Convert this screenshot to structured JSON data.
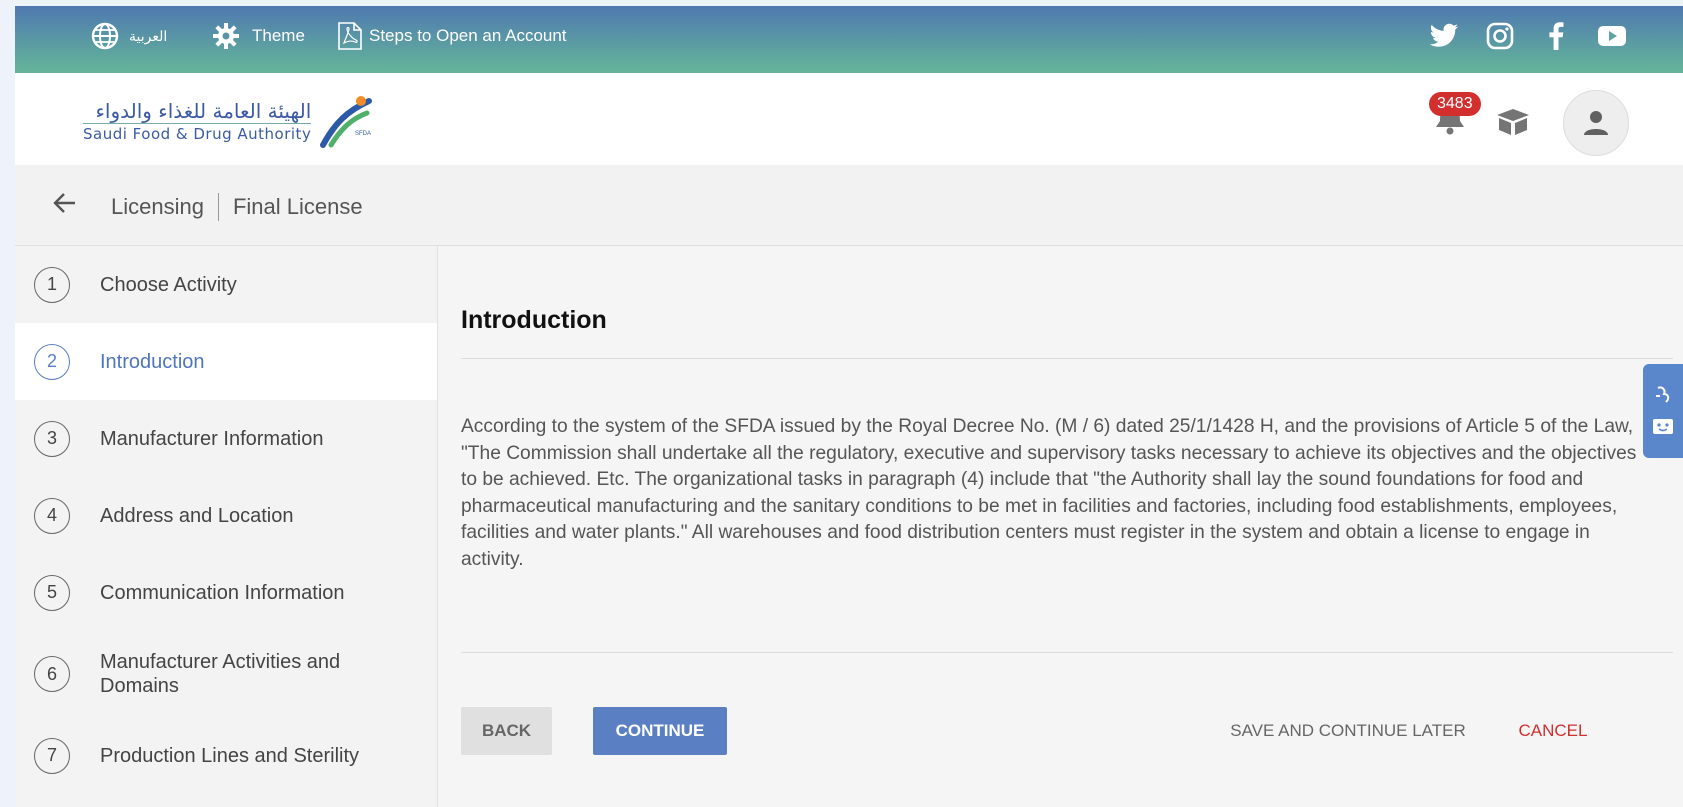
{
  "topbar": {
    "language_label": "العربية",
    "theme_label": "Theme",
    "steps_label": "Steps to Open an Account",
    "social_icons": [
      "twitter-icon",
      "instagram-icon",
      "facebook-icon",
      "youtube-icon"
    ]
  },
  "header": {
    "logo_arabic": "الهيئة العامة للغذاء والدواء",
    "logo_english": "Saudi Food & Drug Authority",
    "logo_mark_text": "SFDA",
    "notification_count": "3483"
  },
  "breadcrumb": {
    "section": "Licensing",
    "page": "Final License"
  },
  "steps": [
    {
      "number": "1",
      "label": "Choose Activity"
    },
    {
      "number": "2",
      "label": "Introduction"
    },
    {
      "number": "3",
      "label": "Manufacturer Information"
    },
    {
      "number": "4",
      "label": "Address and Location"
    },
    {
      "number": "5",
      "label": "Communication Information"
    },
    {
      "number": "6",
      "label": "Manufacturer Activities and Domains"
    },
    {
      "number": "7",
      "label": "Production Lines and Sterility"
    }
  ],
  "main": {
    "title": "Introduction",
    "body": "According to the system of the SFDA issued by the Royal Decree No. (M / 6) dated 25/1/1428 H, and the provisions of Article 5 of the Law, \"The Commission shall undertake all the regulatory, executive and supervisory tasks necessary to achieve its objectives and the objectives to be achieved. Etc. The organizational tasks in paragraph (4) include that \"the Authority shall lay the sound foundations for food and pharmaceutical manufacturing and the sanitary conditions to be met in facilities and factories, including food establishments, employees, facilities and water plants.\" All warehouses and food distribution centers must register in the system and obtain a license to engage in activity.",
    "back_label": "BACK",
    "continue_label": "CONTINUE",
    "save_later_label": "SAVE AND CONTINUE LATER",
    "cancel_label": "CANCEL"
  },
  "colors": {
    "accent": "#5a7fc3",
    "cancel": "#d32f2f",
    "badge": "#d32f2f"
  }
}
